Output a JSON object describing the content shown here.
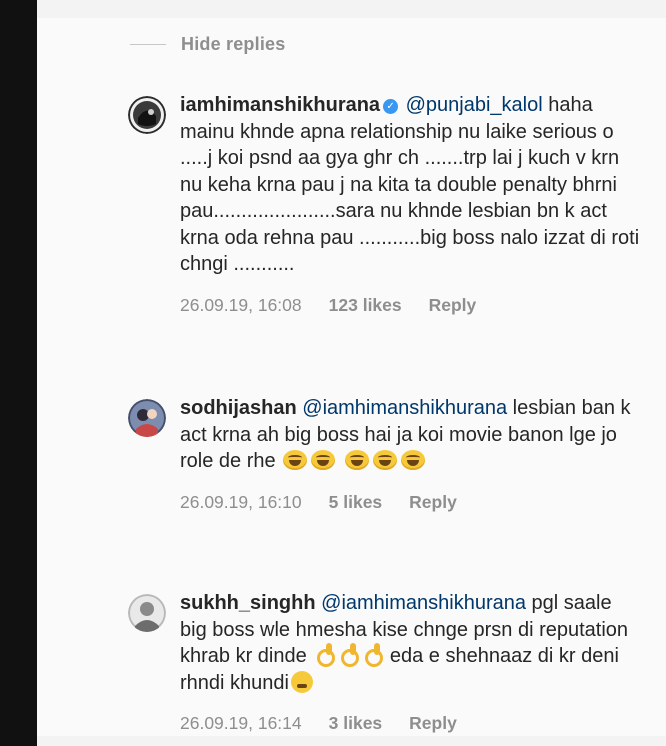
{
  "thread": {
    "hide_replies_label": "Hide replies"
  },
  "comments": [
    {
      "username": "iamhimanshikhurana",
      "verified": true,
      "mention": "@punjabi_kalol",
      "text": "haha mainu khnde apna relationship nu laike serious o .....j koi psnd aa gya ghr ch .......trp lai j kuch v krn nu keha krna pau j na kita ta double penalty bhrni pau......................sara nu khnde lesbian bn k act krna oda rehna pau ...........big boss nalo izzat di roti chngi ...........",
      "date": "26.09.19, 16:08",
      "likes": "123 likes",
      "reply_label": "Reply",
      "avatar_icon": "profile-photo"
    },
    {
      "username": "sodhijashan",
      "verified": false,
      "mention": "@iamhimanshikhurana",
      "text": "lesbian ban k act krna ah big boss hai ja koi movie banon lge jo role de rhe",
      "emoji": [
        "face-with-tears-of-joy",
        "face-with-tears-of-joy",
        "face-with-tears-of-joy",
        "face-with-tears-of-joy",
        "face-with-tears-of-joy"
      ],
      "date": "26.09.19, 16:10",
      "likes": "5 likes",
      "reply_label": "Reply",
      "avatar_icon": "profile-photo"
    },
    {
      "username": "sukhh_singhh",
      "verified": false,
      "mention": "@iamhimanshikhurana",
      "text": "pgl saale big boss wle hmesha kise chnge prsn di reputation khrab kr dinde",
      "text_after": "eda e shehnaaz di kr deni rhndi khundi",
      "emoji": [
        "ok-hand",
        "ok-hand",
        "ok-hand",
        "grimacing-face"
      ],
      "date": "26.09.19, 16:14",
      "likes": "3 likes",
      "reply_label": "Reply",
      "avatar_icon": "profile-photo"
    }
  ],
  "colors": {
    "text": "#262626",
    "secondary": "#8e8e8e",
    "mention": "#00376b",
    "verified": "#3897f0",
    "left_bar": "#111111",
    "background": "#fafafa"
  }
}
